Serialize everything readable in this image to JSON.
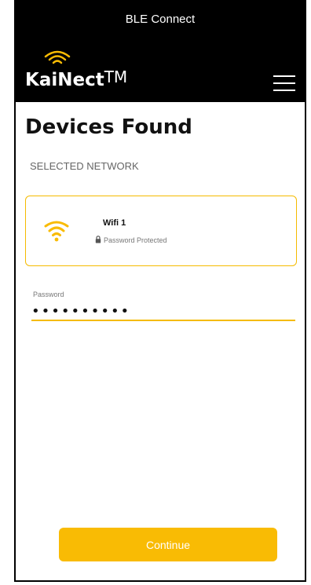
{
  "app": {
    "status_title": "BLE Connect",
    "logo_text": "KaiNect",
    "logo_tm": "TM"
  },
  "page": {
    "title": "Devices Found",
    "section_label": "SELECTED NETWORK"
  },
  "network": {
    "name": "Wifi 1",
    "security": "Password Protected"
  },
  "password": {
    "label": "Password",
    "value": "••••••••••"
  },
  "actions": {
    "continue_label": "Continue"
  },
  "colors": {
    "accent": "#f9bb04",
    "header_bg": "#000000"
  },
  "icons": {
    "logo": "wifi-icon",
    "menu": "hamburger-menu-icon",
    "network": "wifi-icon",
    "security": "lock-icon"
  }
}
